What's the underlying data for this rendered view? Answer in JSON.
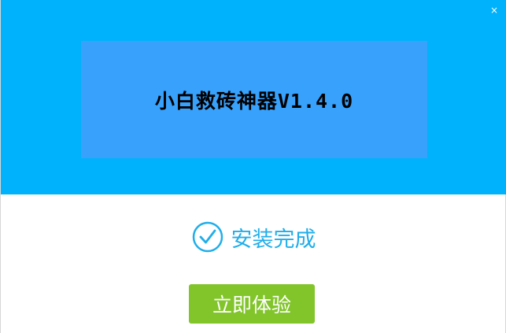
{
  "window": {
    "close_label": "×"
  },
  "banner": {
    "title": "小白救砖神器V1.4.0"
  },
  "status": {
    "icon": "check-circle-icon",
    "text": "安装完成",
    "color": "#20aeea"
  },
  "actions": {
    "primary_label": "立即体验",
    "primary_color": "#82c52b"
  },
  "colors": {
    "header_bg": "#00b2fc",
    "banner_bg": "#37a1fc"
  }
}
